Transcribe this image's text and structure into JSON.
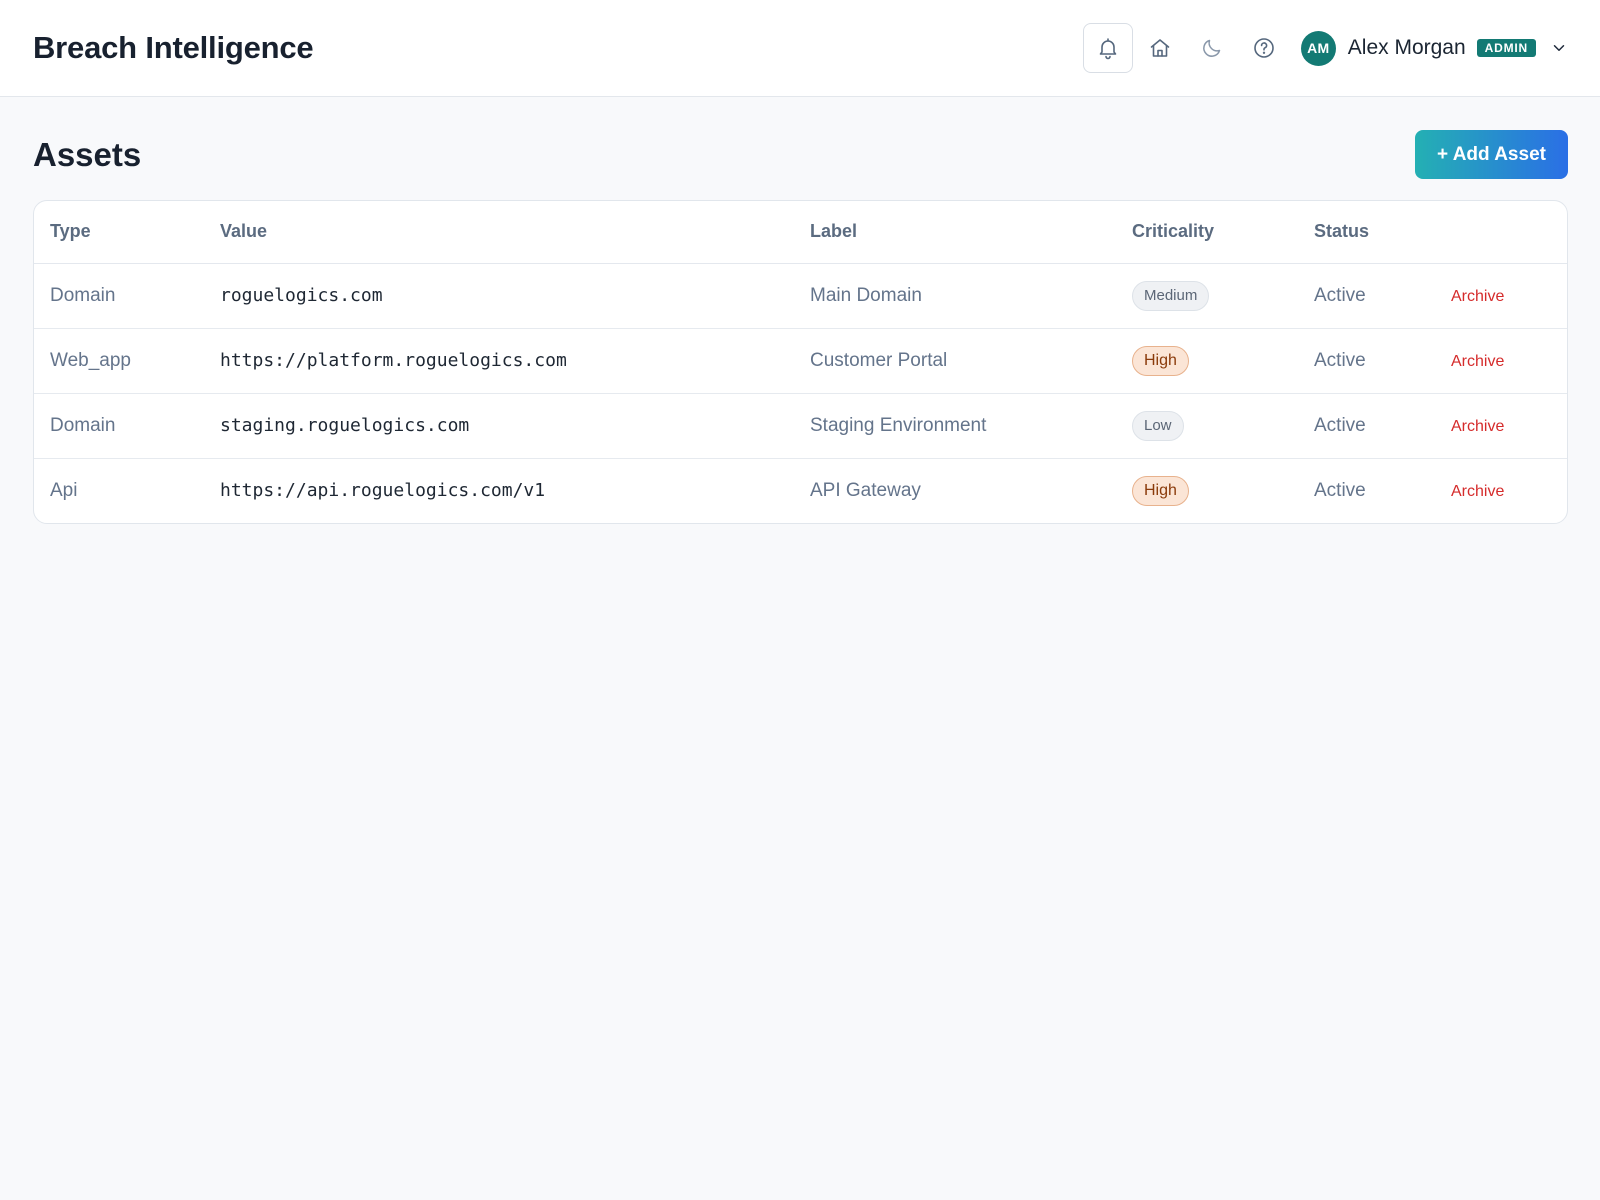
{
  "header": {
    "app_title": "Breach Intelligence",
    "user": {
      "initials": "AM",
      "name": "Alex Morgan",
      "role": "ADMIN"
    },
    "icons": [
      "bell-icon",
      "home-icon",
      "moon-icon",
      "help-icon",
      "chevron-down-icon"
    ]
  },
  "page": {
    "title": "Assets",
    "add_button": "+ Add Asset"
  },
  "table": {
    "columns": [
      "Type",
      "Value",
      "Label",
      "Criticality",
      "Status",
      ""
    ],
    "rows": [
      {
        "type": "Domain",
        "value": "roguelogics.com",
        "label": "Main Domain",
        "criticality": "Medium",
        "status": "Active",
        "action": "Archive"
      },
      {
        "type": "Web_app",
        "value": "https://platform.roguelogics.com",
        "label": "Customer Portal",
        "criticality": "High",
        "status": "Active",
        "action": "Archive"
      },
      {
        "type": "Domain",
        "value": "staging.roguelogics.com",
        "label": "Staging Environment",
        "criticality": "Low",
        "status": "Active",
        "action": "Archive"
      },
      {
        "type": "Api",
        "value": "https://api.roguelogics.com/v1",
        "label": "API Gateway",
        "criticality": "High",
        "status": "Active",
        "action": "Archive"
      }
    ]
  },
  "colors": {
    "accent_teal": "#137a74",
    "button_gradient_start": "#24b0b3",
    "button_gradient_end": "#2a6fe6",
    "archive_red": "#d52b2b",
    "high_badge_bg": "#fbe5d6"
  }
}
